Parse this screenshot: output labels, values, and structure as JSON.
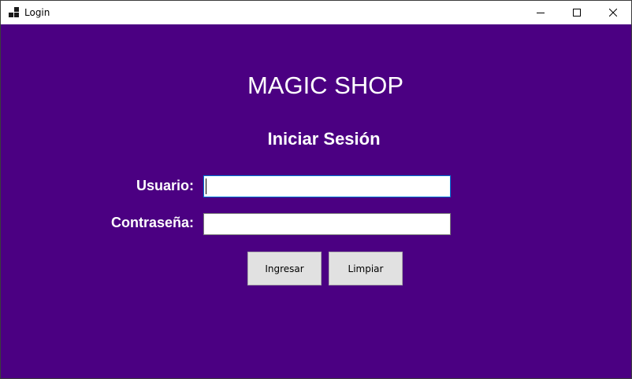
{
  "window": {
    "title": "Login",
    "icon": "app-window-icon",
    "controls": {
      "minimize_icon": "minimize-icon",
      "maximize_icon": "maximize-icon",
      "close_icon": "close-icon"
    }
  },
  "form": {
    "background_color": "#4b0082",
    "shop_title": "MAGIC SHOP",
    "heading": "Iniciar Sesión",
    "username": {
      "label": "Usuario:",
      "value": "",
      "placeholder": ""
    },
    "password": {
      "label": "Contraseña:",
      "value": "",
      "placeholder": ""
    },
    "buttons": {
      "login_label": "Ingresar",
      "clear_label": "Limpiar"
    }
  }
}
